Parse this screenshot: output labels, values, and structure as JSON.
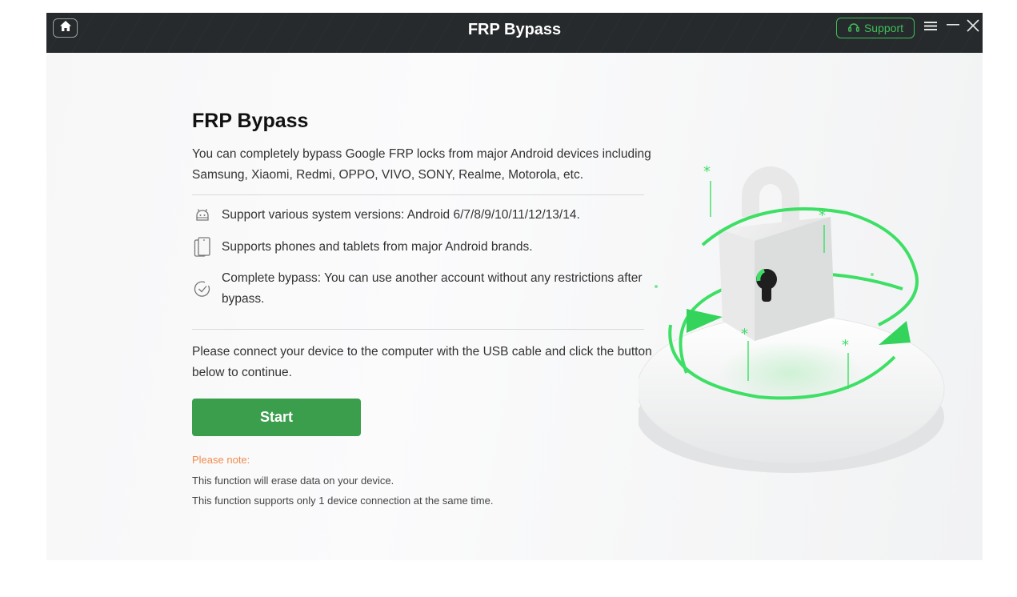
{
  "titlebar": {
    "title": "FRP Bypass",
    "support_label": "Support",
    "home_icon": "home-icon",
    "menu_icon": "menu-icon",
    "minimize_icon": "minimize-icon",
    "close_icon": "close-icon"
  },
  "main": {
    "title": "FRP Bypass",
    "intro": "You can completely bypass Google FRP locks from major Android devices including Samsung, Xiaomi, Redmi, OPPO, VIVO, SONY, Realme, Motorola, etc.",
    "features": [
      {
        "icon": "android-icon",
        "text": "Support various system versions: Android 6/7/8/9/10/11/12/13/14."
      },
      {
        "icon": "phone-tablet-icon",
        "text": "Supports phones and tablets from major Android brands."
      },
      {
        "icon": "check-circle-icon",
        "text": "Complete bypass: You can use another account without any restrictions after bypass."
      }
    ],
    "instructions": "Please connect your device to the computer with the USB cable and click the button below to continue.",
    "start_label": "Start",
    "note_heading": "Please note:",
    "notes": [
      "This function will erase data on your device.",
      "This function supports only 1 device connection at the same time."
    ]
  },
  "colors": {
    "accent": "#3a9e4c",
    "titlebar": "#262a2c",
    "support": "#3fbf5a",
    "note": "#f08c4f"
  }
}
